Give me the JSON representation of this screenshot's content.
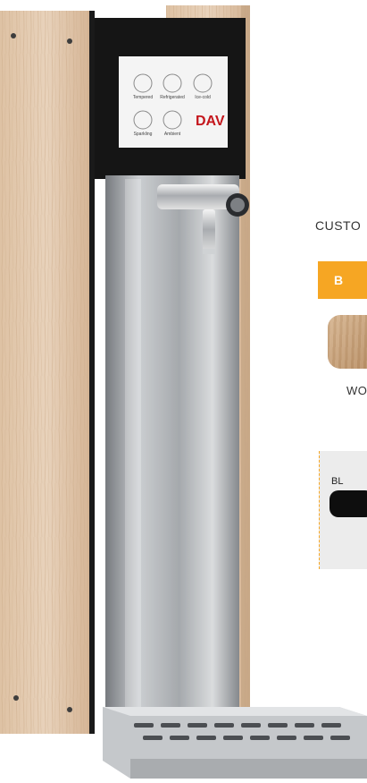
{
  "product": {
    "screen": {
      "buttons": [
        {
          "label": "Tempered",
          "icon": "drop-icon"
        },
        {
          "label": "Refrigerated",
          "icon": "water-glass-icon"
        },
        {
          "label": "Ice-cold",
          "icon": "snowflake-icon"
        },
        {
          "label": "Sparkling",
          "icon": "bubbles-icon"
        },
        {
          "label": "Ambient",
          "icon": "ice-cube-icon"
        }
      ],
      "logo": "DAV"
    }
  },
  "options": {
    "custom_label": "CUSTO",
    "orange_button": "B",
    "wood_label": "WO",
    "black_label": "BL",
    "colors": {
      "accent": "#f6a623",
      "wood": "#d1b08c",
      "black": "#0e0e0e",
      "panel": "#ececec"
    }
  }
}
